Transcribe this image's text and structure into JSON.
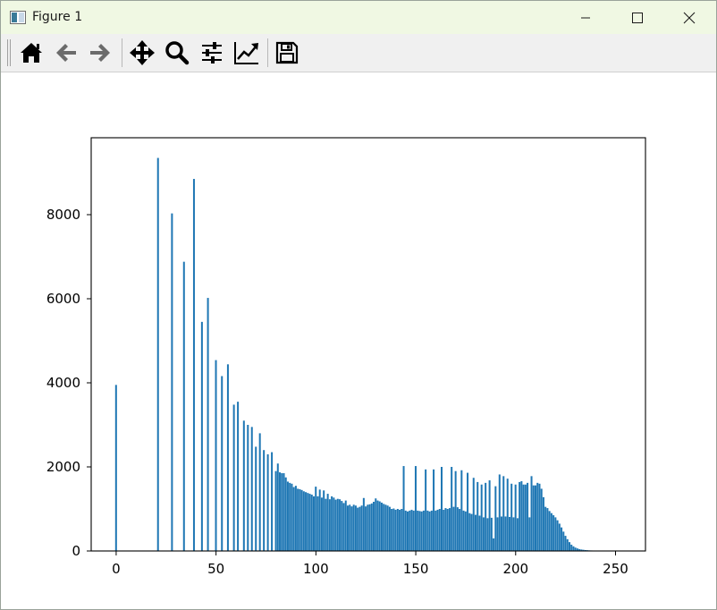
{
  "window": {
    "title": "Figure 1",
    "controls": [
      "minimize-icon",
      "maximize-icon",
      "close-icon"
    ]
  },
  "toolbar": {
    "tools": [
      {
        "name": "home",
        "icon": "home-icon"
      },
      {
        "name": "back",
        "icon": "arrow-left-icon"
      },
      {
        "name": "forward",
        "icon": "arrow-right-icon"
      },
      {
        "name": "pan",
        "icon": "move-icon"
      },
      {
        "name": "zoom",
        "icon": "magnifier-icon"
      },
      {
        "name": "configure-subplots",
        "icon": "sliders-icon"
      },
      {
        "name": "edit-axis",
        "icon": "line-chart-icon"
      },
      {
        "name": "save",
        "icon": "floppy-disk-icon"
      }
    ]
  },
  "colors": {
    "bar": "#1f77b4",
    "titlebar": "#f0f8e3",
    "toolbar": "#f0f0f0"
  },
  "chart_data": {
    "type": "bar",
    "title": "",
    "xlabel": "",
    "ylabel": "",
    "xlim": [
      -12.5,
      265
    ],
    "ylim": [
      0,
      9830
    ],
    "xticks": [
      "0",
      "50",
      "100",
      "150",
      "200",
      "250"
    ],
    "yticks": [
      "0",
      "2000",
      "4000",
      "6000",
      "8000"
    ],
    "grid": false,
    "legend": "none",
    "bin_width": 1,
    "bins": [
      {
        "x": 0,
        "y": 3950
      },
      {
        "x": 21,
        "y": 9350
      },
      {
        "x": 28,
        "y": 8030
      },
      {
        "x": 34,
        "y": 6880
      },
      {
        "x": 39,
        "y": 8850
      },
      {
        "x": 43,
        "y": 5450
      },
      {
        "x": 46,
        "y": 6020
      },
      {
        "x": 50,
        "y": 4540
      },
      {
        "x": 53,
        "y": 4160
      },
      {
        "x": 56,
        "y": 4440
      },
      {
        "x": 59,
        "y": 3480
      },
      {
        "x": 61,
        "y": 3550
      },
      {
        "x": 64,
        "y": 3100
      },
      {
        "x": 66,
        "y": 3000
      },
      {
        "x": 68,
        "y": 2950
      },
      {
        "x": 70,
        "y": 2480
      },
      {
        "x": 72,
        "y": 2800
      },
      {
        "x": 74,
        "y": 2400
      },
      {
        "x": 76,
        "y": 2300
      },
      {
        "x": 78,
        "y": 2350
      },
      {
        "x": 80,
        "y": 1900
      },
      {
        "x": 81,
        "y": 2080
      },
      {
        "x": 82,
        "y": 1870
      },
      {
        "x": 83,
        "y": 1850
      },
      {
        "x": 84,
        "y": 1850
      },
      {
        "x": 85,
        "y": 1750
      },
      {
        "x": 86,
        "y": 1650
      },
      {
        "x": 87,
        "y": 1620
      },
      {
        "x": 88,
        "y": 1600
      },
      {
        "x": 89,
        "y": 1520
      },
      {
        "x": 90,
        "y": 1550
      },
      {
        "x": 91,
        "y": 1480
      },
      {
        "x": 92,
        "y": 1470
      },
      {
        "x": 93,
        "y": 1450
      },
      {
        "x": 94,
        "y": 1420
      },
      {
        "x": 95,
        "y": 1400
      },
      {
        "x": 96,
        "y": 1380
      },
      {
        "x": 97,
        "y": 1360
      },
      {
        "x": 98,
        "y": 1340
      },
      {
        "x": 99,
        "y": 1300
      },
      {
        "x": 100,
        "y": 1530
      },
      {
        "x": 101,
        "y": 1300
      },
      {
        "x": 102,
        "y": 1460
      },
      {
        "x": 103,
        "y": 1270
      },
      {
        "x": 104,
        "y": 1440
      },
      {
        "x": 105,
        "y": 1240
      },
      {
        "x": 106,
        "y": 1360
      },
      {
        "x": 107,
        "y": 1230
      },
      {
        "x": 108,
        "y": 1300
      },
      {
        "x": 109,
        "y": 1270
      },
      {
        "x": 110,
        "y": 1220
      },
      {
        "x": 111,
        "y": 1240
      },
      {
        "x": 112,
        "y": 1230
      },
      {
        "x": 113,
        "y": 1190
      },
      {
        "x": 114,
        "y": 1140
      },
      {
        "x": 115,
        "y": 1200
      },
      {
        "x": 116,
        "y": 1080
      },
      {
        "x": 117,
        "y": 1100
      },
      {
        "x": 118,
        "y": 1060
      },
      {
        "x": 119,
        "y": 1100
      },
      {
        "x": 120,
        "y": 1080
      },
      {
        "x": 121,
        "y": 1030
      },
      {
        "x": 122,
        "y": 1050
      },
      {
        "x": 123,
        "y": 1080
      },
      {
        "x": 124,
        "y": 1260
      },
      {
        "x": 125,
        "y": 1060
      },
      {
        "x": 126,
        "y": 1100
      },
      {
        "x": 127,
        "y": 1110
      },
      {
        "x": 128,
        "y": 1130
      },
      {
        "x": 129,
        "y": 1170
      },
      {
        "x": 130,
        "y": 1250
      },
      {
        "x": 131,
        "y": 1200
      },
      {
        "x": 132,
        "y": 1180
      },
      {
        "x": 133,
        "y": 1150
      },
      {
        "x": 134,
        "y": 1120
      },
      {
        "x": 135,
        "y": 1100
      },
      {
        "x": 136,
        "y": 1080
      },
      {
        "x": 137,
        "y": 1050
      },
      {
        "x": 138,
        "y": 1000
      },
      {
        "x": 139,
        "y": 1010
      },
      {
        "x": 140,
        "y": 980
      },
      {
        "x": 141,
        "y": 1000
      },
      {
        "x": 142,
        "y": 980
      },
      {
        "x": 143,
        "y": 1000
      },
      {
        "x": 144,
        "y": 2020
      },
      {
        "x": 145,
        "y": 960
      },
      {
        "x": 146,
        "y": 940
      },
      {
        "x": 147,
        "y": 960
      },
      {
        "x": 148,
        "y": 980
      },
      {
        "x": 149,
        "y": 960
      },
      {
        "x": 150,
        "y": 2020
      },
      {
        "x": 151,
        "y": 960
      },
      {
        "x": 152,
        "y": 950
      },
      {
        "x": 153,
        "y": 940
      },
      {
        "x": 154,
        "y": 960
      },
      {
        "x": 155,
        "y": 1940
      },
      {
        "x": 156,
        "y": 960
      },
      {
        "x": 157,
        "y": 940
      },
      {
        "x": 158,
        "y": 960
      },
      {
        "x": 159,
        "y": 1940
      },
      {
        "x": 160,
        "y": 960
      },
      {
        "x": 161,
        "y": 980
      },
      {
        "x": 162,
        "y": 1000
      },
      {
        "x": 163,
        "y": 2000
      },
      {
        "x": 164,
        "y": 980
      },
      {
        "x": 165,
        "y": 1020
      },
      {
        "x": 166,
        "y": 1000
      },
      {
        "x": 167,
        "y": 1020
      },
      {
        "x": 168,
        "y": 2000
      },
      {
        "x": 169,
        "y": 1050
      },
      {
        "x": 170,
        "y": 1900
      },
      {
        "x": 171,
        "y": 1040
      },
      {
        "x": 172,
        "y": 1000
      },
      {
        "x": 173,
        "y": 1920
      },
      {
        "x": 174,
        "y": 960
      },
      {
        "x": 175,
        "y": 940
      },
      {
        "x": 176,
        "y": 1860
      },
      {
        "x": 177,
        "y": 900
      },
      {
        "x": 178,
        "y": 880
      },
      {
        "x": 179,
        "y": 1740
      },
      {
        "x": 180,
        "y": 860
      },
      {
        "x": 181,
        "y": 1640
      },
      {
        "x": 182,
        "y": 840
      },
      {
        "x": 183,
        "y": 1580
      },
      {
        "x": 184,
        "y": 800
      },
      {
        "x": 185,
        "y": 1620
      },
      {
        "x": 186,
        "y": 780
      },
      {
        "x": 187,
        "y": 1680
      },
      {
        "x": 188,
        "y": 790
      },
      {
        "x": 189,
        "y": 300
      },
      {
        "x": 190,
        "y": 1540
      },
      {
        "x": 191,
        "y": 800
      },
      {
        "x": 192,
        "y": 1820
      },
      {
        "x": 193,
        "y": 820
      },
      {
        "x": 194,
        "y": 1780
      },
      {
        "x": 195,
        "y": 820
      },
      {
        "x": 196,
        "y": 1720
      },
      {
        "x": 197,
        "y": 810
      },
      {
        "x": 198,
        "y": 1600
      },
      {
        "x": 199,
        "y": 800
      },
      {
        "x": 200,
        "y": 1580
      },
      {
        "x": 201,
        "y": 780
      },
      {
        "x": 202,
        "y": 1640
      },
      {
        "x": 203,
        "y": 1660
      },
      {
        "x": 204,
        "y": 1580
      },
      {
        "x": 205,
        "y": 1580
      },
      {
        "x": 206,
        "y": 1620
      },
      {
        "x": 207,
        "y": 800
      },
      {
        "x": 208,
        "y": 1780
      },
      {
        "x": 209,
        "y": 1560
      },
      {
        "x": 210,
        "y": 1560
      },
      {
        "x": 211,
        "y": 1620
      },
      {
        "x": 212,
        "y": 1600
      },
      {
        "x": 213,
        "y": 1480
      },
      {
        "x": 214,
        "y": 1280
      },
      {
        "x": 215,
        "y": 1050
      },
      {
        "x": 216,
        "y": 1020
      },
      {
        "x": 217,
        "y": 950
      },
      {
        "x": 218,
        "y": 900
      },
      {
        "x": 219,
        "y": 850
      },
      {
        "x": 220,
        "y": 800
      },
      {
        "x": 221,
        "y": 730
      },
      {
        "x": 222,
        "y": 650
      },
      {
        "x": 223,
        "y": 560
      },
      {
        "x": 224,
        "y": 460
      },
      {
        "x": 225,
        "y": 360
      },
      {
        "x": 226,
        "y": 280
      },
      {
        "x": 227,
        "y": 210
      },
      {
        "x": 228,
        "y": 150
      },
      {
        "x": 229,
        "y": 110
      },
      {
        "x": 230,
        "y": 80
      },
      {
        "x": 231,
        "y": 60
      },
      {
        "x": 232,
        "y": 45
      },
      {
        "x": 233,
        "y": 35
      },
      {
        "x": 234,
        "y": 28
      },
      {
        "x": 235,
        "y": 22
      },
      {
        "x": 236,
        "y": 18
      },
      {
        "x": 237,
        "y": 14
      },
      {
        "x": 238,
        "y": 12
      },
      {
        "x": 239,
        "y": 10
      },
      {
        "x": 240,
        "y": 9
      },
      {
        "x": 241,
        "y": 8
      },
      {
        "x": 242,
        "y": 7
      },
      {
        "x": 243,
        "y": 6
      },
      {
        "x": 244,
        "y": 5
      },
      {
        "x": 245,
        "y": 4
      },
      {
        "x": 246,
        "y": 3
      },
      {
        "x": 247,
        "y": 3
      },
      {
        "x": 248,
        "y": 2
      },
      {
        "x": 249,
        "y": 2
      },
      {
        "x": 250,
        "y": 1
      }
    ]
  }
}
